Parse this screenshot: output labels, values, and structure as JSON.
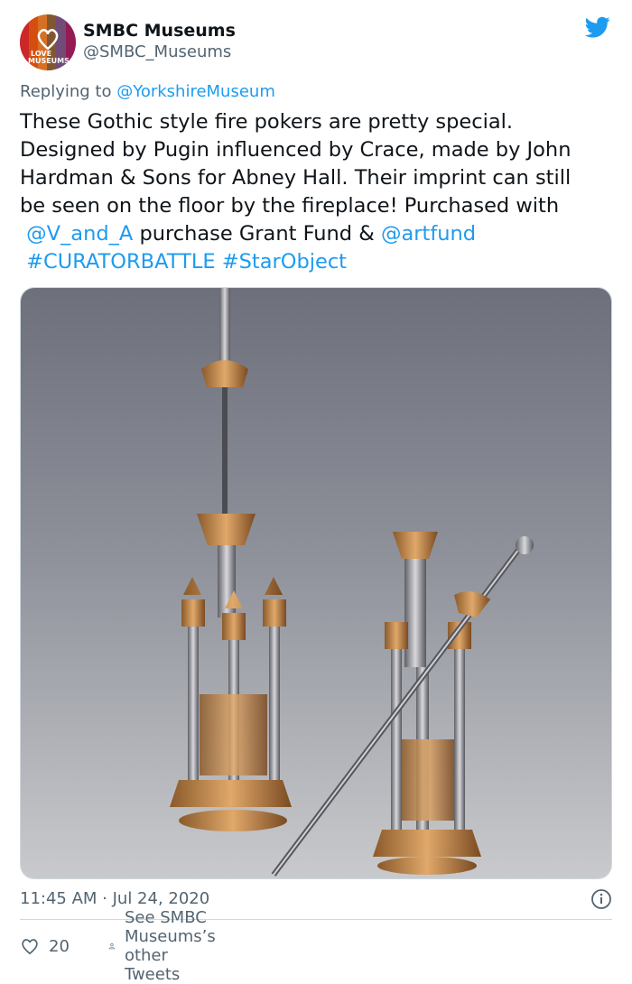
{
  "author": {
    "display_name": "SMBC Museums",
    "handle": "@SMBC_Museums",
    "avatar_text_top": "LOVE",
    "avatar_text_bottom": "MUSEUMS"
  },
  "reply": {
    "prefix": "Replying to",
    "to": "@YorkshireMuseum"
  },
  "tweet": {
    "line1": "These Gothic style fire pokers are pretty special.",
    "line2": "Designed by Pugin influenced by Crace, made by John",
    "line3": "Hardman & Sons for Abney Hall. Their imprint can still",
    "line4": "be seen on the floor by the fireplace! Purchased with",
    "mention1": "@V_and_A",
    "line5_mid": "purchase Grant Fund &",
    "mention2": "@artfund",
    "hashtag1": "#CURATORBATTLE",
    "hashtag2": "#StarObject"
  },
  "timestamp": "11:45 AM · Jul 24, 2020",
  "actions": {
    "likes": "20",
    "see_other": "See SMBC Museums’s other Tweets"
  },
  "icons": [
    "twitter-bird-icon",
    "info-icon",
    "heart-icon",
    "person-icon"
  ],
  "colors": {
    "link": "#1d9bf0",
    "secondary_text": "#536471",
    "text": "#0f1419",
    "divider": "#cfd9de"
  }
}
